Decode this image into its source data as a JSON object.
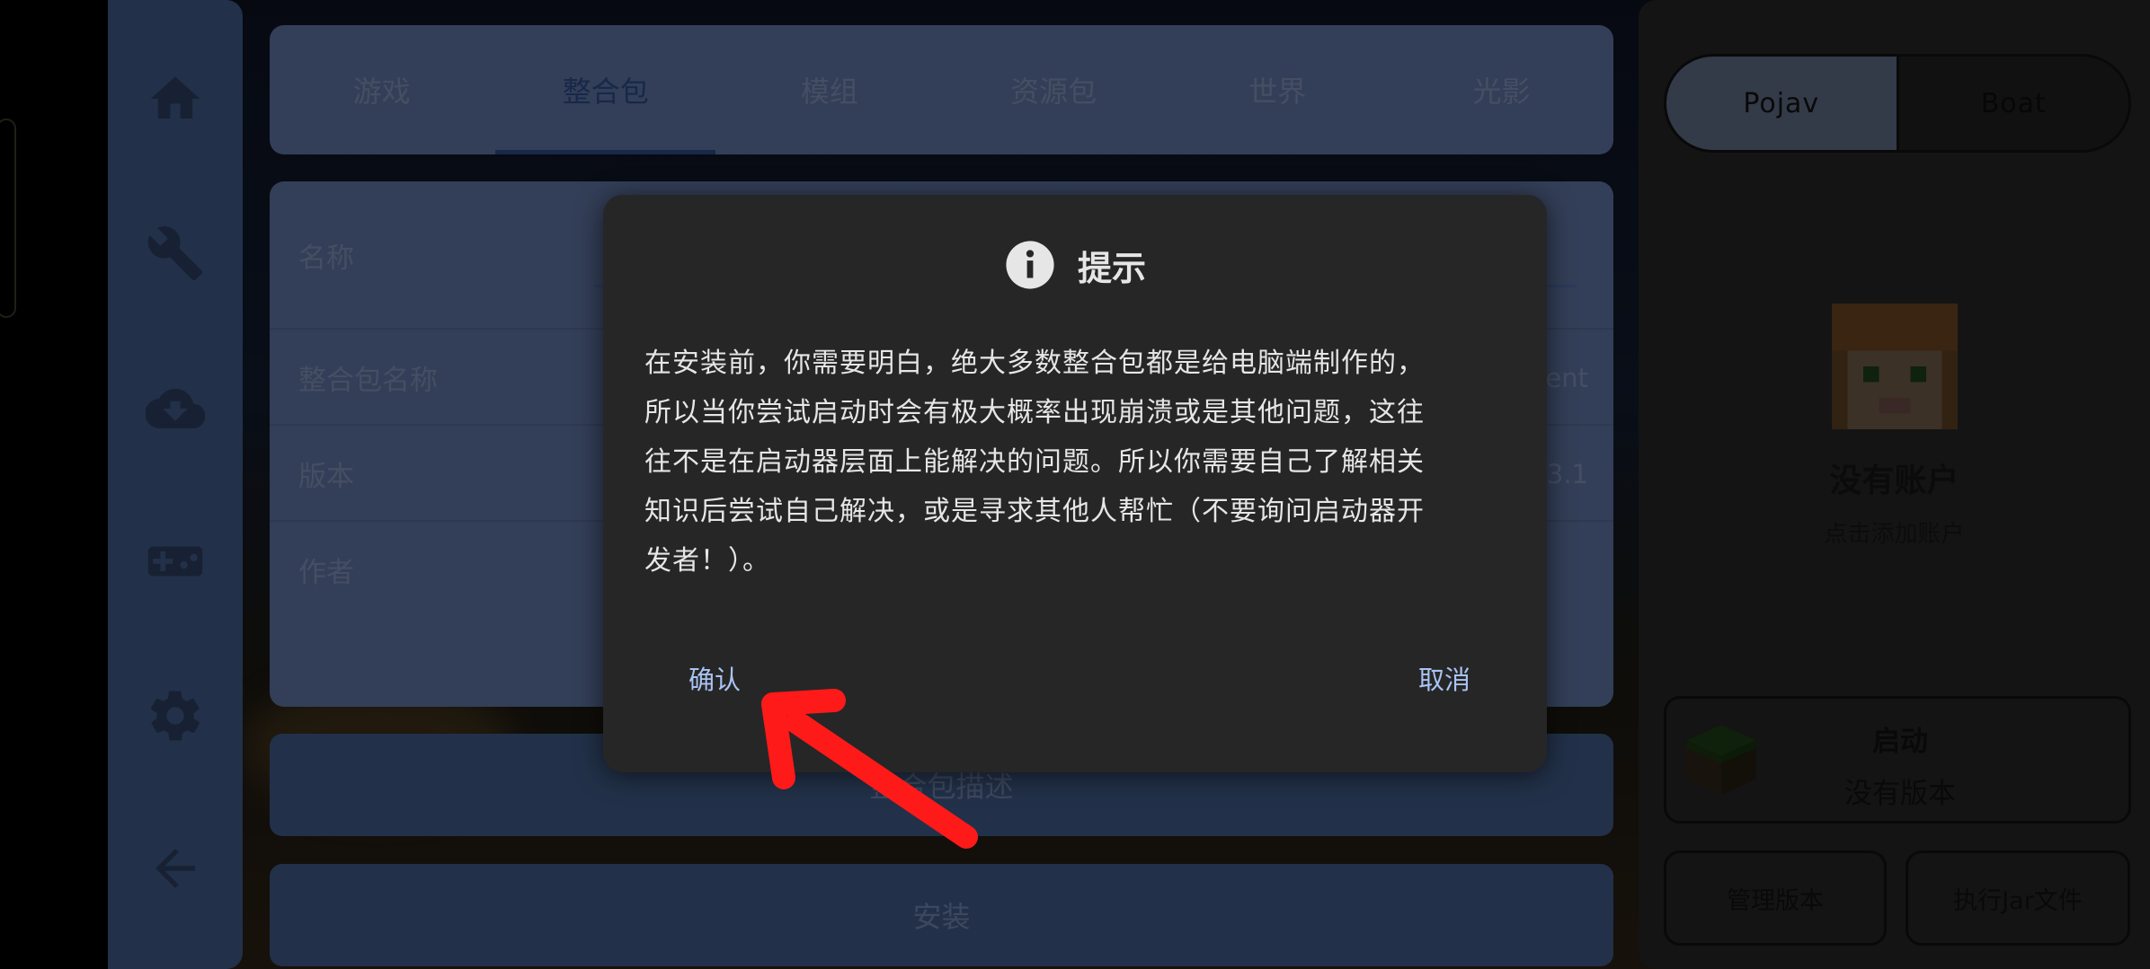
{
  "nav": {
    "items": [
      "home-icon",
      "wrench-icon",
      "cloud-download-icon",
      "gamepad-icon",
      "gear-icon",
      "back-arrow-icon"
    ]
  },
  "tabs": [
    "游戏",
    "整合包",
    "模组",
    "资源包",
    "世界",
    "光影"
  ],
  "active_tab": "整合包",
  "form": {
    "name_label": "名称",
    "modpack_name_label": "整合包名称",
    "modpack_name_value": "ent",
    "version_label": "版本",
    "version_value": "3.1",
    "author_label": "作者"
  },
  "buttons": {
    "description": "整合包描述",
    "install": "安装"
  },
  "right_panel": {
    "toggle_pojav": "Pojav",
    "toggle_boat": "Boat",
    "account_name": "没有账户",
    "account_sub": "点击添加账户",
    "launch_title": "启动",
    "launch_sub": "没有版本",
    "manage_versions": "管理版本",
    "run_jar": "执行Jar文件"
  },
  "dialog": {
    "title": "提示",
    "lines": [
      "在安装前，你需要明白，绝大多数整合包都是给电脑端制作的，",
      "所以当你尝试启动时会有极大概率出现崩溃或是其他问题，这往",
      "往不是在启动器层面上能解决的问题。所以你需要自己了解相关",
      "知识后尝试自己解决，或是寻求其他人帮忙（不要询问启动器开",
      "发者！）。"
    ],
    "confirm": "确认",
    "cancel": "取消"
  },
  "colors": {
    "nav_bg": "#3f5a86",
    "panel_bg": "#5d73a0",
    "dialog_bg": "#262626",
    "dialog_button": "#a9c3f2",
    "annotation_arrow": "#ff1a1a"
  }
}
